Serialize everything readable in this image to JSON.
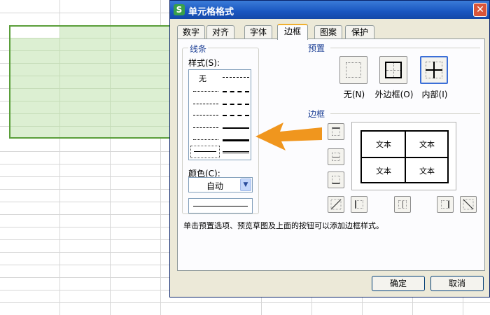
{
  "dialog": {
    "title": "单元格格式",
    "app_icon": "S",
    "close_glyph": "✕"
  },
  "tabs": [
    {
      "label": "数字"
    },
    {
      "label": "对齐"
    },
    {
      "label": "字体"
    },
    {
      "label": "边框",
      "active": true
    },
    {
      "label": "图案"
    },
    {
      "label": "保护"
    }
  ],
  "line_group": {
    "title": "线条",
    "style_label": "样式(S):",
    "style_none": "无",
    "color_label": "颜色(C):",
    "color_value": "自动"
  },
  "presets": {
    "title": "预置",
    "none_label": "无(N)",
    "outline_label": "外边框(O)",
    "inside_label": "内部(I)"
  },
  "border": {
    "title": "边框",
    "preview_cells": [
      "文本",
      "文本",
      "文本",
      "文本"
    ]
  },
  "hint": "单击预置选项、预览草图及上面的按钮可以添加边框样式。",
  "buttons": {
    "ok": "确定",
    "cancel": "取消"
  },
  "colors": {
    "accent_arrow": "#f0961e",
    "selection_fill": "#dcefd2",
    "selection_border": "#5a9e3a",
    "titlebar": "#1a56c0"
  }
}
